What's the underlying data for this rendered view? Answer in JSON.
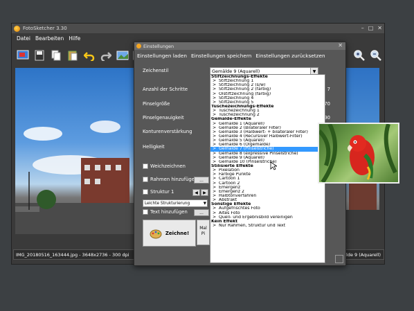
{
  "app": {
    "title": "FotoSketcher 3.30",
    "menu": [
      "Datei",
      "Bearbeiten",
      "Hilfe"
    ],
    "window_controls": [
      "minimize",
      "maximize",
      "close"
    ],
    "status_left": "IMG_20180516_163444.jpg - 3648x2736 - 300 dpi",
    "status_right": "Gemälde 9 (Aquarell)",
    "toolbar_icons": [
      "open-image-icon",
      "save-icon",
      "copy-icon",
      "paste-icon",
      "undo-icon",
      "redo-icon",
      "image-icon",
      "landscape-icon"
    ],
    "toolbar_right_icons": [
      "zoom-in-icon",
      "zoom-out-icon"
    ]
  },
  "dialog": {
    "title": "Einstellungen",
    "menu": [
      "Einstellungen laden",
      "Einstellungen speichern",
      "Einstellungen zurücksetzen"
    ],
    "style_label": "Zeichenstil",
    "style_value": "Gemälde 9 (Aquarell)",
    "settings": [
      {
        "label": "Anzahl der Schritte",
        "value": "7"
      },
      {
        "label": "Pinselgröße",
        "value": "170"
      },
      {
        "label": "Pinselgenauigkeit",
        "value": "90"
      },
      {
        "label": "Konturenverstärkung",
        "value": ""
      },
      {
        "label": "Helligkeit",
        "value": ""
      }
    ],
    "checkboxes": {
      "weichzeichnen": "Weichzeichnen",
      "rahmen": "Rahmen hinzufügen",
      "struktur": "Struktur 1",
      "text": "Text hinzufügen"
    },
    "structure_select": "Leichte Strukturierung",
    "more_button": "...",
    "zeichne_button": "Zeichne!",
    "mal_button": "Mal Pi"
  },
  "dropdown": [
    {
      "type": "header",
      "text": "Stiftzeichnungs-Effekte"
    },
    {
      "type": "item",
      "text": "Stiftzeichnung 1"
    },
    {
      "type": "item",
      "text": "Stiftzeichnung 2 (s/w)"
    },
    {
      "type": "item",
      "text": "Stiftzeichnung 2 (farbig)"
    },
    {
      "type": "item",
      "text": "Ölstiftzeichnung (farbig)"
    },
    {
      "type": "item",
      "text": "Stiftzeichnung 4"
    },
    {
      "type": "item",
      "text": "Stiftzeichnung 5"
    },
    {
      "type": "header",
      "text": "Tuschezeichnungs-Effekte"
    },
    {
      "type": "item",
      "text": "Tuschezeichnung 1"
    },
    {
      "type": "item",
      "text": "Tuschezeichnung 2"
    },
    {
      "type": "header",
      "text": "Gemälde-Effekte"
    },
    {
      "type": "item",
      "text": "Gemälde 1 (Aquarell)"
    },
    {
      "type": "item",
      "text": "Gemälde 2 (Bilateraler Filter)"
    },
    {
      "type": "item",
      "text": "Gemälde 3 (Halbwert- + bilateraler Filter)"
    },
    {
      "type": "item",
      "text": "Gemälde 4 (Recursiver Halbwert-Filter)"
    },
    {
      "type": "item",
      "text": "Gemälde 5 (Aquarell)"
    },
    {
      "type": "item",
      "text": "Gemälde 6 (Ölgemälde)"
    },
    {
      "type": "item",
      "text": "Gemälde 7 (Pinselstriche)",
      "selected": true
    },
    {
      "type": "item",
      "text": "Gemälde 8 (expressive Pinselstriche)"
    },
    {
      "type": "item",
      "text": "Gemälde 9 (Aquarell)"
    },
    {
      "type": "item",
      "text": "Gemälde 10 (Pinselstriche)"
    },
    {
      "type": "header",
      "text": "Stilisierte Effekte"
    },
    {
      "type": "item",
      "text": "Pixelation"
    },
    {
      "type": "item",
      "text": "Farbige Punkte"
    },
    {
      "type": "item",
      "text": "Cartoon 1"
    },
    {
      "type": "item",
      "text": "Cartoon 2"
    },
    {
      "type": "item",
      "text": "Emergenz"
    },
    {
      "type": "item",
      "text": "Emergenz 2"
    },
    {
      "type": "item",
      "text": "Halbtonverfahren"
    },
    {
      "type": "item",
      "text": "Abstrakt"
    },
    {
      "type": "header",
      "text": "Sonstige Effekte"
    },
    {
      "type": "item",
      "text": "Aufgefrischtes Foto"
    },
    {
      "type": "item",
      "text": "Altes Foto"
    },
    {
      "type": "item",
      "text": "Quell- und Ergebnisbild vereinigen"
    },
    {
      "type": "header",
      "text": "Kein Effekt"
    },
    {
      "type": "item",
      "text": "Nur Rahmen, Struktur und Text"
    }
  ]
}
